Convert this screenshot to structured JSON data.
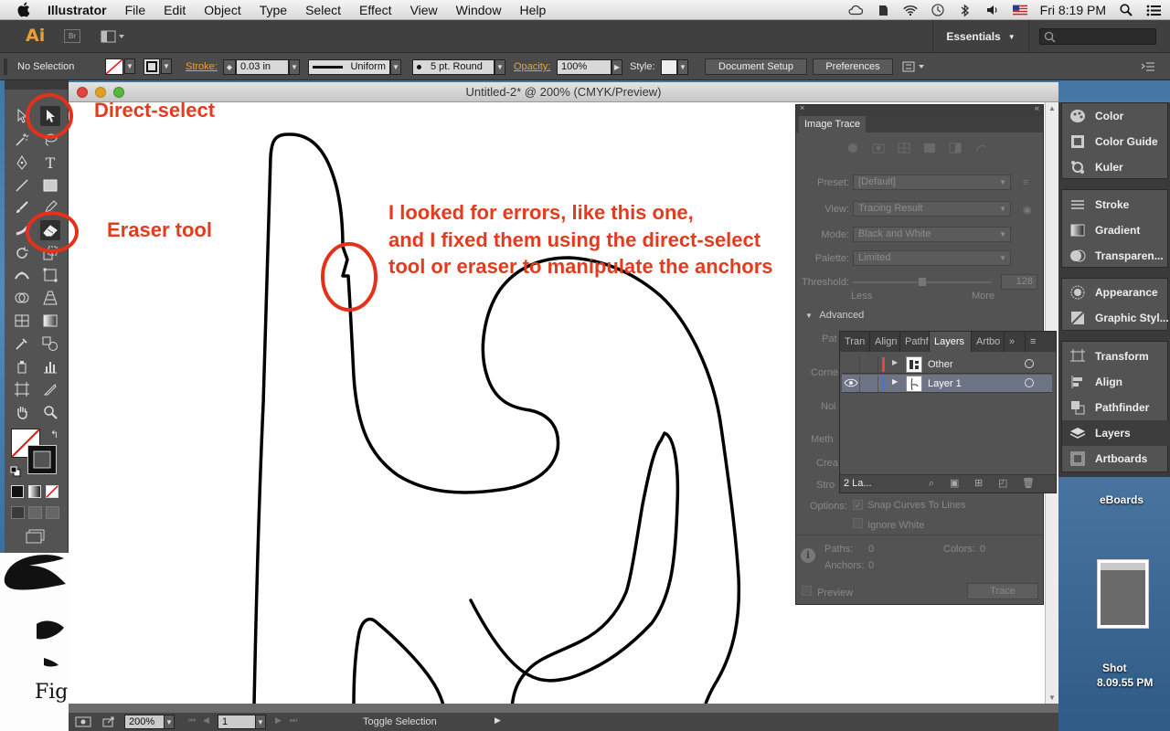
{
  "menubar": {
    "app_name": "Illustrator",
    "items": [
      "File",
      "Edit",
      "Object",
      "Type",
      "Select",
      "Effect",
      "View",
      "Window",
      "Help"
    ],
    "clock": "Fri 8:19 PM"
  },
  "appbar": {
    "logo": "Ai",
    "bridge": "Br",
    "workspace": "Essentials"
  },
  "control": {
    "selection": "No Selection",
    "stroke_label": "Stroke:",
    "stroke_value": "0.03 in",
    "profile": "Uniform",
    "brush": "5 pt. Round",
    "opacity_label": "Opacity:",
    "opacity_value": "100%",
    "style_label": "Style:",
    "document_setup": "Document Setup",
    "preferences": "Preferences"
  },
  "document": {
    "title": "Untitled-2* @ 200% (CMYK/Preview)",
    "zoom": "200%",
    "artboard": "1",
    "status": "Toggle Selection"
  },
  "annotations": {
    "direct_select": "Direct-select",
    "eraser": "Eraser tool",
    "note_line1": "I looked for errors, like this one,",
    "note_line2": "and I fixed them using the direct-select",
    "note_line3": "tool or eraser to manipulate the anchors"
  },
  "image_trace": {
    "title": "Image Trace",
    "preset_label": "Preset:",
    "preset_value": "[Default]",
    "view_label": "View:",
    "view_value": "Tracing Result",
    "mode_label": "Mode:",
    "mode_value": "Black and White",
    "palette_label": "Palette:",
    "palette_value": "Limited",
    "threshold_label": "Threshold:",
    "threshold_value": "128",
    "less": "Less",
    "more": "More",
    "advanced": "Advanced",
    "paths_partial": "Pat",
    "corners_partial": "Corne",
    "noise_partial": "Noi",
    "method_partial": "Meth",
    "create_partial": "Crea",
    "stroke_partial": "Stro",
    "options_label": "Options:",
    "snap_curves": "Snap Curves To Lines",
    "ignore_white": "Ignore White",
    "paths_label": "Paths:",
    "paths_value": "0",
    "colors_label": "Colors:",
    "colors_value": "0",
    "anchors_label": "Anchors:",
    "anchors_value": "0",
    "preview": "Preview",
    "trace": "Trace"
  },
  "layers_panel": {
    "tabs": [
      "Tran",
      "Align",
      "Pathf",
      "Layers",
      "Artbo"
    ],
    "layers": [
      {
        "name": "Other",
        "color": "#e04848"
      },
      {
        "name": "Layer 1",
        "color": "#4a6fe0"
      }
    ],
    "count": "2 La..."
  },
  "dock": {
    "items": [
      "Color",
      "Color Guide",
      "Kuler",
      "Stroke",
      "Gradient",
      "Transparen...",
      "Appearance",
      "Graphic Styl...",
      "Transform",
      "Align",
      "Pathfinder",
      "Layers",
      "Artboards"
    ],
    "active": "Layers"
  },
  "desktop": {
    "label1": "eBoards",
    "label2a": "Shot",
    "label2b": "8.09.55 PM",
    "bg_doc_text": "Fig"
  },
  "colors": {
    "annotation": "#e3311a",
    "ai_orange": "#e8a13a"
  }
}
